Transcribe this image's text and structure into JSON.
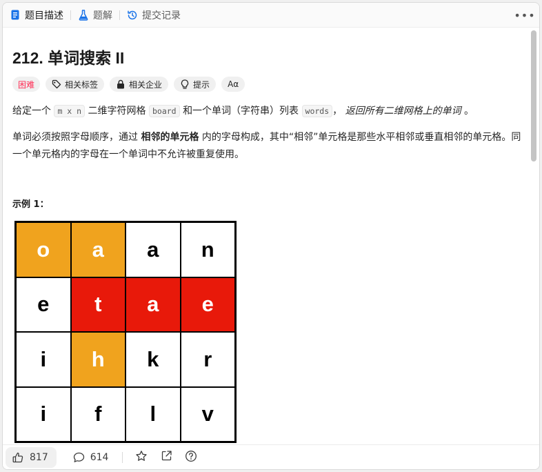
{
  "tabs": [
    {
      "label": "题目描述",
      "icon": "document-icon",
      "active": true
    },
    {
      "label": "题解",
      "icon": "flask-icon",
      "active": false
    },
    {
      "label": "提交记录",
      "icon": "history-icon",
      "active": false
    }
  ],
  "problem": {
    "title": "212. 单词搜索 II",
    "difficulty": "困难",
    "tags": [
      "相关标签",
      "相关企业",
      "提示"
    ],
    "font_toggle": "Aα"
  },
  "description": {
    "p1_prefix": "给定一个",
    "p1_code1": "m x n",
    "p1_mid1": "二维字符网格",
    "p1_code2": "board",
    "p1_mid2": "和一个单词（字符串）列表",
    "p1_code3": "words",
    "p1_sep": "，",
    "p1_em": "返回所有二维网格上的单词",
    "p1_end": "。",
    "p2_prefix": "单词必须按照字母顺序，通过",
    "p2_strong": "相邻的单元格",
    "p2_suffix": "内的字母构成，其中“相邻”单元格是那些水平相邻或垂直相邻的单元格。同一个单元格内的字母在一个单词中不允许被重复使用。"
  },
  "example": {
    "title": "示例 1：",
    "grid": [
      [
        {
          "ch": "o",
          "color": "orange"
        },
        {
          "ch": "a",
          "color": "orange"
        },
        {
          "ch": "a",
          "color": "white"
        },
        {
          "ch": "n",
          "color": "white"
        }
      ],
      [
        {
          "ch": "e",
          "color": "white"
        },
        {
          "ch": "t",
          "color": "red"
        },
        {
          "ch": "a",
          "color": "red"
        },
        {
          "ch": "e",
          "color": "red"
        }
      ],
      [
        {
          "ch": "i",
          "color": "white"
        },
        {
          "ch": "h",
          "color": "orange"
        },
        {
          "ch": "k",
          "color": "white"
        },
        {
          "ch": "r",
          "color": "white"
        }
      ],
      [
        {
          "ch": "i",
          "color": "white"
        },
        {
          "ch": "f",
          "color": "white"
        },
        {
          "ch": "l",
          "color": "white"
        },
        {
          "ch": "v",
          "color": "white"
        }
      ]
    ],
    "colors": {
      "orange": "#f0a31e",
      "red": "#e8190a",
      "white": "#ffffff"
    }
  },
  "footer": {
    "likes": "817",
    "comments": "614"
  },
  "colors": {
    "difficulty_hard": "#ff2d55",
    "accent_blue": "#007aff"
  }
}
